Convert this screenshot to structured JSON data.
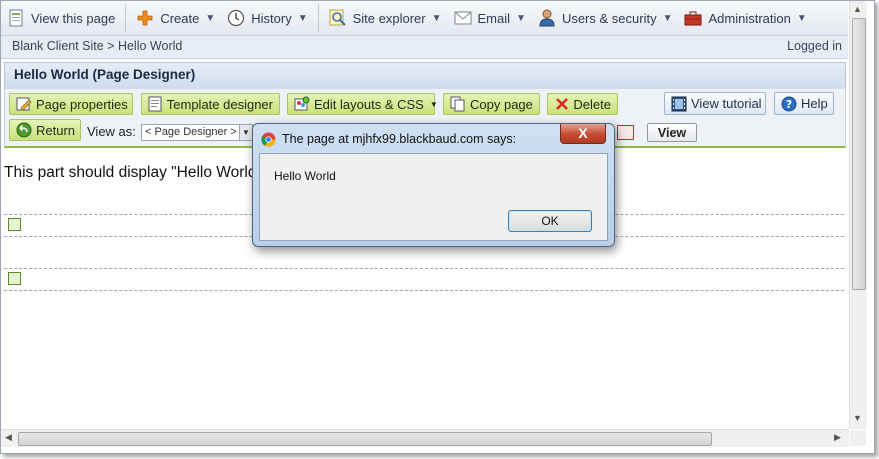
{
  "nav": {
    "items": [
      {
        "label": "View this page",
        "icon": "page-icon",
        "caret": false
      },
      {
        "label": "Create",
        "icon": "plus-icon",
        "caret": true
      },
      {
        "label": "History",
        "icon": "clock-icon",
        "caret": true
      },
      {
        "label": "Site explorer",
        "icon": "magnifier-icon",
        "caret": true
      },
      {
        "label": "Email",
        "icon": "envelope-icon",
        "caret": true
      },
      {
        "label": "Users & security",
        "icon": "user-icon",
        "caret": true
      },
      {
        "label": "Administration",
        "icon": "toolbox-icon",
        "caret": true
      }
    ]
  },
  "breadcrumb": "Blank Client Site > Hello World",
  "login_status": "Logged in",
  "page_title": "Hello World (Page Designer)",
  "toolbar": {
    "page_properties": "Page properties",
    "template_designer": "Template designer",
    "edit_layouts": "Edit layouts & CSS",
    "copy_page": "Copy page",
    "delete": "Delete",
    "view_tutorial": "View tutorial",
    "help": "Help",
    "return": "Return",
    "view_as_label": "View as:",
    "view_as_value": "< Page Designer >",
    "view_button": "View"
  },
  "content": {
    "text": "This part should display \"Hello World"
  },
  "dialog": {
    "title": "The page at mjhfx99.blackbaud.com says:",
    "message": "Hello World",
    "ok": "OK",
    "close": "X"
  },
  "colors": {
    "accent_green": "#c8e27a",
    "nav_bg": "#e4e9f0",
    "dialog_frame": "#b9cfe9",
    "close_red": "#c44a32"
  }
}
